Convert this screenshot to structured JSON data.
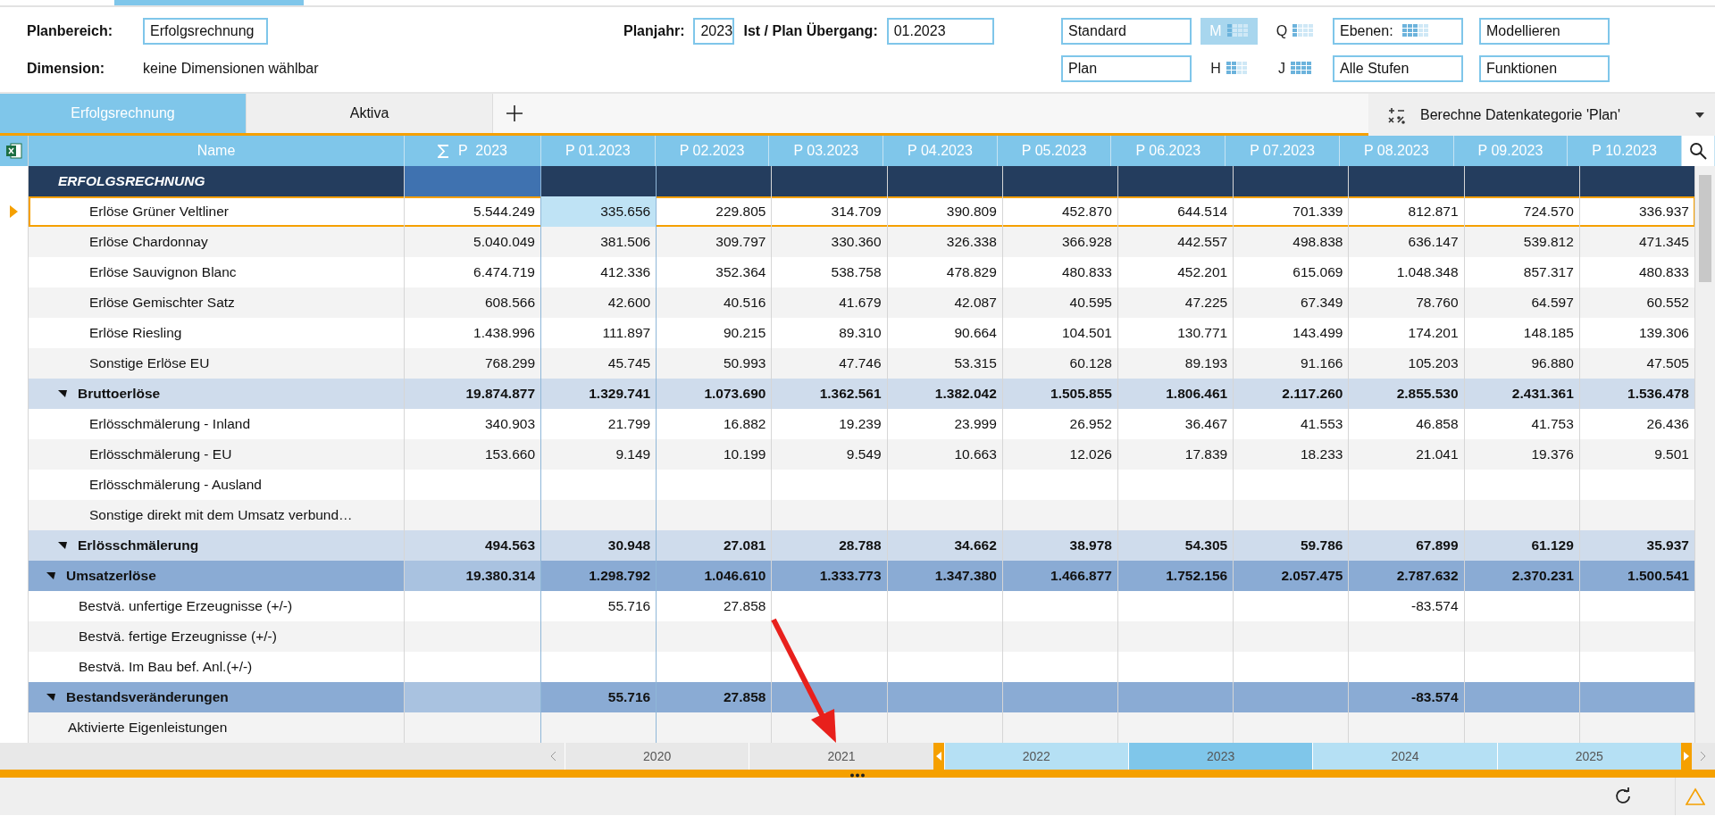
{
  "top_bar": {
    "planbereich": {
      "label": "Planbereich:",
      "value": "Erfolgsrechnung"
    },
    "dimension": {
      "label": "Dimension:",
      "text": "keine Dimensionen wählbar"
    },
    "planjahr": {
      "label": "Planjahr:",
      "value": "2023"
    },
    "uebergang": {
      "label": "Ist / Plan Übergang:",
      "value": "01.2023"
    },
    "scenario_fields": [
      "Standard",
      "Plan"
    ],
    "periods": [
      {
        "label": "M",
        "selected": true
      },
      {
        "label": "Q",
        "selected": false
      },
      {
        "label": "H",
        "selected": false
      },
      {
        "label": "J",
        "selected": false
      }
    ],
    "ebenen": "Ebenen:",
    "stufen": "Alle Stufen",
    "actions": [
      "Modellieren",
      "Funktionen"
    ]
  },
  "tabs": [
    {
      "label": "Erfolgsrechnung",
      "selected": true
    },
    {
      "label": "Aktiva",
      "selected": false
    }
  ],
  "calc_button": "Berechne Datenkategorie 'Plan'",
  "table": {
    "name_column": "Name",
    "columns": [
      {
        "label": "P  2023",
        "kind": "sum"
      },
      {
        "label": "P 01.2023",
        "kind": "month"
      },
      {
        "label": "P 02.2023",
        "kind": "month"
      },
      {
        "label": "P 03.2023",
        "kind": "month"
      },
      {
        "label": "P 04.2023",
        "kind": "month"
      },
      {
        "label": "P 05.2023",
        "kind": "month"
      },
      {
        "label": "P 06.2023",
        "kind": "month"
      },
      {
        "label": "P 07.2023",
        "kind": "month"
      },
      {
        "label": "P 08.2023",
        "kind": "month"
      },
      {
        "label": "P 09.2023",
        "kind": "month"
      },
      {
        "label": "P 10.2023",
        "kind": "month"
      }
    ],
    "rows": [
      {
        "kind": "section",
        "name": "ERFOLGSRECHNUNG",
        "selected": false,
        "children": [
          {
            "kind": "group",
            "name": "Umsatzerlöse",
            "selected": false,
            "expanded": true,
            "cells": [
              {
                "value": "19.380.314",
                "selected": false
              },
              {
                "value": "1.298.792",
                "selected": false
              },
              {
                "value": "1.046.610",
                "selected": false
              },
              {
                "value": "1.333.773",
                "selected": false
              },
              {
                "value": "1.347.380",
                "selected": false
              },
              {
                "value": "1.466.877",
                "selected": false
              },
              {
                "value": "1.752.156",
                "selected": false
              },
              {
                "value": "2.057.475",
                "selected": false
              },
              {
                "value": "2.787.632",
                "selected": false
              },
              {
                "value": "2.370.231",
                "selected": false
              },
              {
                "value": "1.500.541",
                "selected": false
              }
            ],
            "children": [
              {
                "kind": "group",
                "name": "Bruttoerlöse",
                "selected": false,
                "expanded": true,
                "cells": [
                  {
                    "value": "19.874.877",
                    "selected": false
                  },
                  {
                    "value": "1.329.741",
                    "selected": false
                  },
                  {
                    "value": "1.073.690",
                    "selected": false
                  },
                  {
                    "value": "1.362.561",
                    "selected": false
                  },
                  {
                    "value": "1.382.042",
                    "selected": false
                  },
                  {
                    "value": "1.505.855",
                    "selected": false
                  },
                  {
                    "value": "1.806.461",
                    "selected": false
                  },
                  {
                    "value": "2.117.260",
                    "selected": false
                  },
                  {
                    "value": "2.855.530",
                    "selected": false
                  },
                  {
                    "value": "2.431.361",
                    "selected": false
                  },
                  {
                    "value": "1.536.478",
                    "selected": false
                  }
                ],
                "children": [
                  {
                    "kind": "item",
                    "name": "Erlöse Grüner Veltliner",
                    "selected": true,
                    "cells": [
                      {
                        "value": "5.544.249",
                        "selected": false
                      },
                      {
                        "value": "335.656",
                        "selected": true
                      },
                      {
                        "value": "229.805",
                        "selected": false
                      },
                      {
                        "value": "314.709",
                        "selected": false
                      },
                      {
                        "value": "390.809",
                        "selected": false
                      },
                      {
                        "value": "452.870",
                        "selected": false
                      },
                      {
                        "value": "644.514",
                        "selected": false
                      },
                      {
                        "value": "701.339",
                        "selected": false
                      },
                      {
                        "value": "812.871",
                        "selected": false
                      },
                      {
                        "value": "724.570",
                        "selected": false
                      },
                      {
                        "value": "336.937",
                        "selected": false
                      }
                    ]
                  },
                  {
                    "kind": "item",
                    "name": "Erlöse Chardonnay",
                    "selected": false,
                    "cells": [
                      {
                        "value": "5.040.049",
                        "selected": false
                      },
                      {
                        "value": "381.506",
                        "selected": false
                      },
                      {
                        "value": "309.797",
                        "selected": false
                      },
                      {
                        "value": "330.360",
                        "selected": false
                      },
                      {
                        "value": "326.338",
                        "selected": false
                      },
                      {
                        "value": "366.928",
                        "selected": false
                      },
                      {
                        "value": "442.557",
                        "selected": false
                      },
                      {
                        "value": "498.838",
                        "selected": false
                      },
                      {
                        "value": "636.147",
                        "selected": false
                      },
                      {
                        "value": "539.812",
                        "selected": false
                      },
                      {
                        "value": "471.345",
                        "selected": false
                      }
                    ]
                  },
                  {
                    "kind": "item",
                    "name": "Erlöse Sauvignon Blanc",
                    "selected": false,
                    "cells": [
                      {
                        "value": "6.474.719",
                        "selected": false
                      },
                      {
                        "value": "412.336",
                        "selected": false
                      },
                      {
                        "value": "352.364",
                        "selected": false
                      },
                      {
                        "value": "538.758",
                        "selected": false
                      },
                      {
                        "value": "478.829",
                        "selected": false
                      },
                      {
                        "value": "480.833",
                        "selected": false
                      },
                      {
                        "value": "452.201",
                        "selected": false
                      },
                      {
                        "value": "615.069",
                        "selected": false
                      },
                      {
                        "value": "1.048.348",
                        "selected": false
                      },
                      {
                        "value": "857.317",
                        "selected": false
                      },
                      {
                        "value": "480.833",
                        "selected": false
                      }
                    ]
                  },
                  {
                    "kind": "item",
                    "name": "Erlöse Gemischter Satz",
                    "selected": false,
                    "cells": [
                      {
                        "value": "608.566",
                        "selected": false
                      },
                      {
                        "value": "42.600",
                        "selected": false
                      },
                      {
                        "value": "40.516",
                        "selected": false
                      },
                      {
                        "value": "41.679",
                        "selected": false
                      },
                      {
                        "value": "42.087",
                        "selected": false
                      },
                      {
                        "value": "40.595",
                        "selected": false
                      },
                      {
                        "value": "47.225",
                        "selected": false
                      },
                      {
                        "value": "67.349",
                        "selected": false
                      },
                      {
                        "value": "78.760",
                        "selected": false
                      },
                      {
                        "value": "64.597",
                        "selected": false
                      },
                      {
                        "value": "60.552",
                        "selected": false
                      }
                    ]
                  },
                  {
                    "kind": "item",
                    "name": "Erlöse Riesling",
                    "selected": false,
                    "cells": [
                      {
                        "value": "1.438.996",
                        "selected": false
                      },
                      {
                        "value": "111.897",
                        "selected": false
                      },
                      {
                        "value": "90.215",
                        "selected": false
                      },
                      {
                        "value": "89.310",
                        "selected": false
                      },
                      {
                        "value": "90.664",
                        "selected": false
                      },
                      {
                        "value": "104.501",
                        "selected": false
                      },
                      {
                        "value": "130.771",
                        "selected": false
                      },
                      {
                        "value": "143.499",
                        "selected": false
                      },
                      {
                        "value": "174.201",
                        "selected": false
                      },
                      {
                        "value": "148.185",
                        "selected": false
                      },
                      {
                        "value": "139.306",
                        "selected": false
                      }
                    ]
                  },
                  {
                    "kind": "item",
                    "name": "Sonstige Erlöse EU",
                    "selected": false,
                    "cells": [
                      {
                        "value": "768.299",
                        "selected": false
                      },
                      {
                        "value": "45.745",
                        "selected": false
                      },
                      {
                        "value": "50.993",
                        "selected": false
                      },
                      {
                        "value": "47.746",
                        "selected": false
                      },
                      {
                        "value": "53.315",
                        "selected": false
                      },
                      {
                        "value": "60.128",
                        "selected": false
                      },
                      {
                        "value": "89.193",
                        "selected": false
                      },
                      {
                        "value": "91.166",
                        "selected": false
                      },
                      {
                        "value": "105.203",
                        "selected": false
                      },
                      {
                        "value": "96.880",
                        "selected": false
                      },
                      {
                        "value": "47.505",
                        "selected": false
                      }
                    ]
                  }
                ]
              },
              {
                "kind": "group",
                "name": "Erlösschmälerung",
                "selected": false,
                "expanded": true,
                "cells": [
                  {
                    "value": "494.563",
                    "selected": false
                  },
                  {
                    "value": "30.948",
                    "selected": false
                  },
                  {
                    "value": "27.081",
                    "selected": false
                  },
                  {
                    "value": "28.788",
                    "selected": false
                  },
                  {
                    "value": "34.662",
                    "selected": false
                  },
                  {
                    "value": "38.978",
                    "selected": false
                  },
                  {
                    "value": "54.305",
                    "selected": false
                  },
                  {
                    "value": "59.786",
                    "selected": false
                  },
                  {
                    "value": "67.899",
                    "selected": false
                  },
                  {
                    "value": "61.129",
                    "selected": false
                  },
                  {
                    "value": "35.937",
                    "selected": false
                  }
                ],
                "children": [
                  {
                    "kind": "item",
                    "name": "Erlösschmälerung - Inland",
                    "selected": false,
                    "cells": [
                      {
                        "value": "340.903",
                        "selected": false
                      },
                      {
                        "value": "21.799",
                        "selected": false
                      },
                      {
                        "value": "16.882",
                        "selected": false
                      },
                      {
                        "value": "19.239",
                        "selected": false
                      },
                      {
                        "value": "23.999",
                        "selected": false
                      },
                      {
                        "value": "26.952",
                        "selected": false
                      },
                      {
                        "value": "36.467",
                        "selected": false
                      },
                      {
                        "value": "41.553",
                        "selected": false
                      },
                      {
                        "value": "46.858",
                        "selected": false
                      },
                      {
                        "value": "41.753",
                        "selected": false
                      },
                      {
                        "value": "26.436",
                        "selected": false
                      }
                    ]
                  },
                  {
                    "kind": "item",
                    "name": "Erlösschmälerung - EU",
                    "selected": false,
                    "cells": [
                      {
                        "value": "153.660",
                        "selected": false
                      },
                      {
                        "value": "9.149",
                        "selected": false
                      },
                      {
                        "value": "10.199",
                        "selected": false
                      },
                      {
                        "value": "9.549",
                        "selected": false
                      },
                      {
                        "value": "10.663",
                        "selected": false
                      },
                      {
                        "value": "12.026",
                        "selected": false
                      },
                      {
                        "value": "17.839",
                        "selected": false
                      },
                      {
                        "value": "18.233",
                        "selected": false
                      },
                      {
                        "value": "21.041",
                        "selected": false
                      },
                      {
                        "value": "19.376",
                        "selected": false
                      },
                      {
                        "value": "9.501",
                        "selected": false
                      }
                    ]
                  },
                  {
                    "kind": "item",
                    "name": "Erlösschmälerung - Ausland",
                    "selected": false
                  },
                  {
                    "kind": "item",
                    "name": "Sonstige direkt mit dem Umsatz verbund…",
                    "selected": false
                  }
                ]
              }
            ]
          },
          {
            "kind": "group",
            "name": "Bestandsveränderungen",
            "selected": false,
            "expanded": true,
            "cells": [
              {
                "kind": "empty"
              },
              {
                "kind": "value",
                "value": "55.716",
                "selected": false
              },
              {
                "kind": "value",
                "value": "27.858",
                "selected": false
              },
              {
                "kind": "empty"
              },
              {
                "kind": "empty"
              },
              {
                "kind": "empty"
              },
              {
                "kind": "empty"
              },
              {
                "kind": "empty"
              },
              {
                "kind": "value",
                "value": "-83.574",
                "selected": false
              },
              {
                "kind": "empty"
              },
              {
                "kind": "empty"
              }
            ],
            "children": [
              {
                "kind": "item",
                "name": "Bestvä. unfertige Erzeugnisse (+/-)",
                "selected": false,
                "cells": [
                  {
                    "kind": "empty"
                  },
                  {
                    "kind": "value",
                    "value": "55.716",
                    "selected": false
                  },
                  {
                    "kind": "value",
                    "value": "27.858",
                    "selected": false
                  },
                  {
                    "kind": "empty"
                  },
                  {
                    "kind": "empty"
                  },
                  {
                    "kind": "empty"
                  },
                  {
                    "kind": "empty"
                  },
                  {
                    "kind": "empty"
                  },
                  {
                    "kind": "value",
                    "value": "-83.574",
                    "selected": false
                  },
                  {
                    "kind": "empty"
                  },
                  {
                    "kind": "empty"
                  }
                ]
              },
              {
                "kind": "item",
                "name": "Bestvä. fertige Erzeugnisse (+/-)",
                "selected": false
              },
              {
                "kind": "item",
                "name": "Bestvä. Im Bau bef. Anl.(+/-)",
                "selected": false
              }
            ]
          },
          {
            "kind": "item",
            "name": "Aktivierte Eigenleistungen",
            "selected": false
          }
        ]
      }
    ]
  },
  "timeline": {
    "years": [
      {
        "label": "2020",
        "selected": false,
        "in_range": false
      },
      {
        "label": "2021",
        "selected": false,
        "in_range": false
      },
      {
        "label": "2022",
        "selected": false,
        "in_range": true
      },
      {
        "label": "2023",
        "selected": true,
        "in_range": true
      },
      {
        "label": "2024",
        "selected": false,
        "in_range": true
      },
      {
        "label": "2025",
        "selected": false,
        "in_range": true
      }
    ]
  }
}
